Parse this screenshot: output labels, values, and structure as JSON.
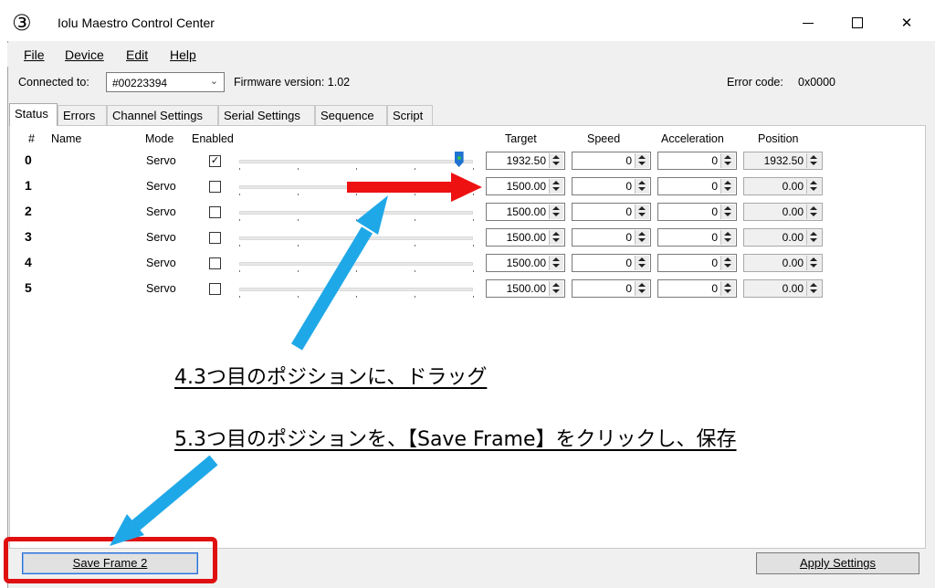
{
  "window": {
    "step_badge": "③",
    "title": "Iolu Maestro Control Center",
    "minimize_label": "",
    "close_glyph": "✕"
  },
  "menu": [
    {
      "label": "File"
    },
    {
      "label": "Device"
    },
    {
      "label": "Edit"
    },
    {
      "label": "Help"
    }
  ],
  "connection": {
    "connected_label": "Connected to:",
    "device_value": "#00223394",
    "firmware_label": "Firmware version: 1.02",
    "error_label": "Error code:",
    "error_value": "0x0000"
  },
  "tabs": [
    "Status",
    "Errors",
    "Channel Settings",
    "Serial Settings",
    "Sequence",
    "Script"
  ],
  "active_tab": "Status",
  "columns": {
    "num": "#",
    "name": "Name",
    "mode": "Mode",
    "enabled": "Enabled",
    "target": "Target",
    "speed": "Speed",
    "acceleration": "Acceleration",
    "position": "Position"
  },
  "channels": [
    {
      "num": "0",
      "mode": "Servo",
      "enabled": true,
      "check": "✓",
      "target": "1932.50",
      "speed": "0",
      "acceleration": "0",
      "position": "1932.50",
      "slider_fraction": 0.94
    },
    {
      "num": "1",
      "mode": "Servo",
      "enabled": false,
      "check": "",
      "target": "1500.00",
      "speed": "0",
      "acceleration": "0",
      "position": "0.00"
    },
    {
      "num": "2",
      "mode": "Servo",
      "enabled": false,
      "check": "",
      "target": "1500.00",
      "speed": "0",
      "acceleration": "0",
      "position": "0.00"
    },
    {
      "num": "3",
      "mode": "Servo",
      "enabled": false,
      "check": "",
      "target": "1500.00",
      "speed": "0",
      "acceleration": "0",
      "position": "0.00"
    },
    {
      "num": "4",
      "mode": "Servo",
      "enabled": false,
      "check": "",
      "target": "1500.00",
      "speed": "0",
      "acceleration": "0",
      "position": "0.00"
    },
    {
      "num": "5",
      "mode": "Servo",
      "enabled": false,
      "check": "",
      "target": "1500.00",
      "speed": "0",
      "acceleration": "0",
      "position": "0.00"
    }
  ],
  "annotations": {
    "step4": "4.3つ目のポジションに、ドラッグ",
    "step5": "5.3つ目のポジションを、【Save Frame】をクリックし、保存"
  },
  "buttons": {
    "save_frame": "Save Frame 2",
    "apply_settings": "Apply Settings"
  },
  "colors": {
    "red_arrow": "#ee1111",
    "blue_arrow": "#1fa8e8",
    "highlight_border": "#e01010",
    "slider_thumb": "#1e73d2"
  }
}
